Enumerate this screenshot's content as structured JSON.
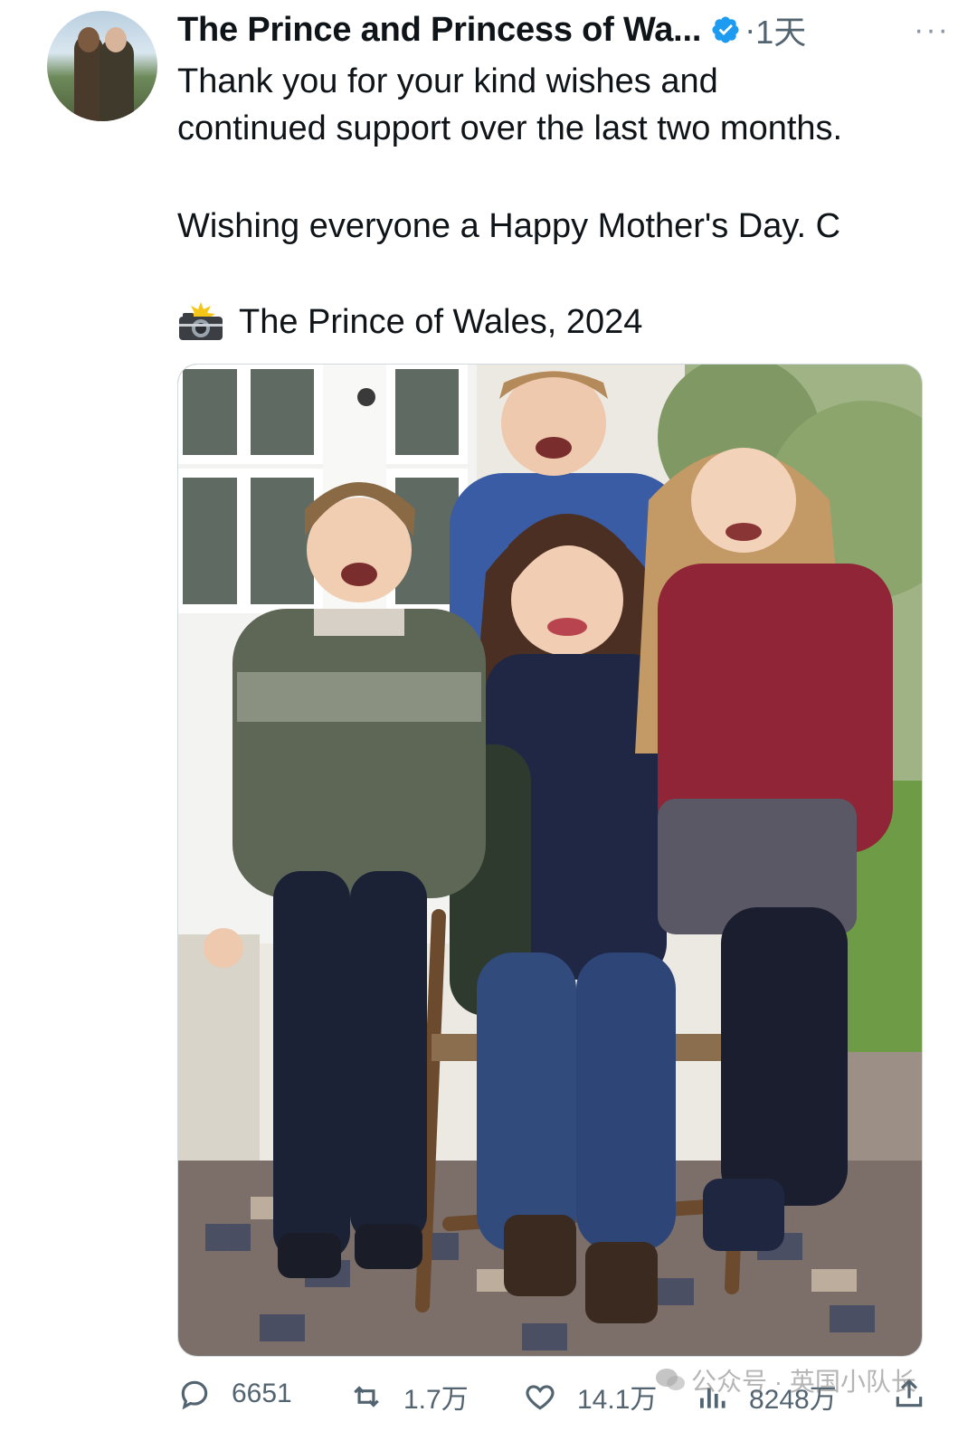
{
  "post": {
    "author": "The Prince and Princess of Wa...",
    "separator": "·",
    "time": "1天",
    "more": "···",
    "text_line1": "Thank you for your kind wishes and",
    "text_line2": "continued support over the last two months.",
    "text_line3": "Wishing everyone a Happy Mother's Day. C",
    "credit": "The Prince of Wales, 2024"
  },
  "icons": {
    "avatar": "avatar",
    "verified": "verified-badge-icon",
    "camera": "camera-flash-icon",
    "reply": "reply-icon",
    "repost": "repost-icon",
    "like": "heart-icon",
    "views": "views-icon",
    "share": "share-icon"
  },
  "colors": {
    "verified": "#1d9bf0",
    "muted": "#536471"
  },
  "stats": {
    "replies": "6651",
    "reposts": "1.7万",
    "likes": "14.1万",
    "views": "8248万"
  },
  "watermark": "公众号 · 英国小队长"
}
